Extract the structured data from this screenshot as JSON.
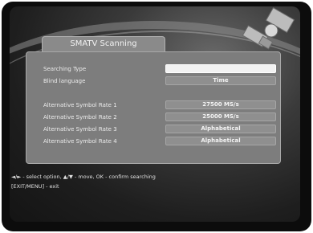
{
  "window": {
    "title": "SMATV Scanning"
  },
  "fields": [
    {
      "label": "Searching Type",
      "value": ""
    },
    {
      "label": "Blind language",
      "value": "Time"
    }
  ],
  "symbol_rates": [
    {
      "label": "Alternative Symbol Rate 1",
      "value": "27500 MS/s"
    },
    {
      "label": "Alternative Symbol Rate 2",
      "value": "25000 MS/s"
    },
    {
      "label": "Alternative Symbol Rate 3",
      "value": "Alphabetical"
    },
    {
      "label": "Alternative Symbol Rate 4",
      "value": "Alphabetical"
    }
  ],
  "help": {
    "line1": "◄/► - select option, ▲/▼ - move, OK - confirm searching",
    "line2": "[EXIT/MENU] - exit"
  },
  "colors": {
    "panel": "#7d7d7d",
    "highlight": "#f2f2f2",
    "background": "#1e1e1e"
  }
}
